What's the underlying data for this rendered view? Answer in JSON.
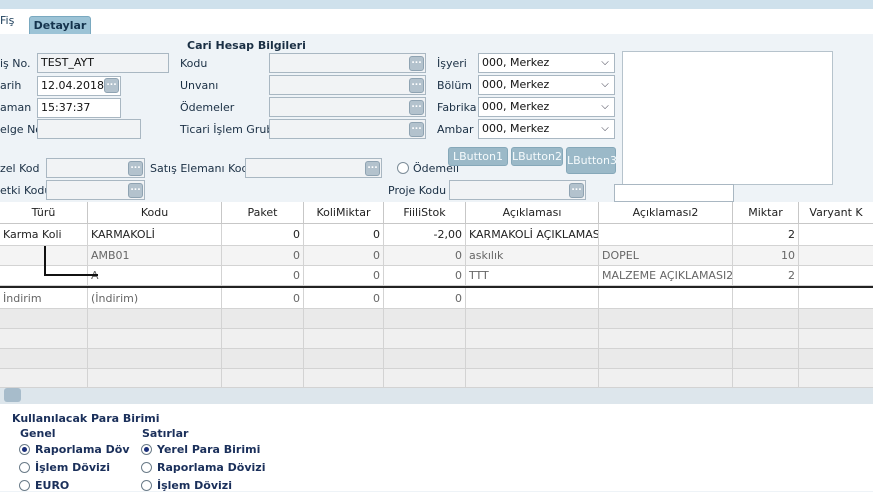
{
  "tabs": {
    "fis": "Fiş",
    "detaylar": "Detaylar"
  },
  "header": {
    "section_title": "Cari Hesap Bilgileri"
  },
  "fields": {
    "fis_no_label": "iş No.",
    "fis_no_value": "TEST_AYT",
    "tarih_label": "arih",
    "tarih_value": "12.04.2018",
    "zaman_label": "aman",
    "zaman_value": "15:37:37",
    "belge_label": "elge No.",
    "belge_value": "",
    "kodu_label": "Kodu",
    "kodu_value": "",
    "unvani_label": "Unvanı",
    "unvani_value": "",
    "odemeler_label": "Ödemeler",
    "odemeler_value": "",
    "ticari_label": "Ticari İşlem Grubu",
    "ticari_value": "",
    "isyeri_label": "İşyeri",
    "isyeri_value": "000, Merkez",
    "bolum_label": "Bölüm",
    "bolum_value": "000, Merkez",
    "fabrika_label": "Fabrika",
    "fabrika_value": "000, Merkez",
    "ambar_label": "Ambar",
    "ambar_value": "000, Merkez",
    "ozel_kod_label": "zel Kod",
    "ozel_kod_value": "",
    "satis_label": "Satış Elemanı Kodu",
    "satis_value": "",
    "odemeli_label": "Ödemeli",
    "yetki_label": "etki Kodu",
    "yetki_value": "",
    "proje_label": "Proje Kodu",
    "proje_value": "",
    "dots": "..."
  },
  "buttons": {
    "lbutton1": "LButton1",
    "lbutton2": "LButton2",
    "lbutton3": "LButton3"
  },
  "grid": {
    "columns": [
      "Türü",
      "Kodu",
      "Paket",
      "KoliMiktar",
      "FiiliStok",
      "Açıklaması",
      "Açıklaması2",
      "Miktar",
      "Varyant K"
    ],
    "rows": [
      {
        "turu": "Karma Koli",
        "kodu": "KARMAKOLİ",
        "paket": "0",
        "koli": "0",
        "fiili": "-2,00",
        "aciklama": "KARMAKOLİ AÇIKLAMASI",
        "aciklama2": "",
        "miktar": "2"
      },
      {
        "turu": "",
        "kodu": "AMB01",
        "paket": "0",
        "koli": "0",
        "fiili": "0",
        "aciklama": "askılık",
        "aciklama2": "DOPEL",
        "miktar": "10"
      },
      {
        "turu": "",
        "kodu": "A",
        "paket": "0",
        "koli": "0",
        "fiili": "0",
        "aciklama": "TTT",
        "aciklama2": "MALZEME AÇIKLAMASI2",
        "miktar": "2"
      },
      {
        "turu": "İndirim",
        "kodu": "(İndirim)",
        "paket": "0",
        "koli": "0",
        "fiili": "0",
        "aciklama": "",
        "aciklama2": "",
        "miktar": ""
      }
    ]
  },
  "currency": {
    "title": "Kullanılacak Para Birimi",
    "genel_title": "Genel",
    "genel_options": [
      "Raporlama Döv",
      "İşlem Dövizi",
      "EURO"
    ],
    "satirlar_title": "Satırlar",
    "satirlar_options": [
      "Yerel Para Birimi",
      "Raporlama Dövizi",
      "İşlem Dövizi"
    ]
  },
  "colors": {
    "accent": "#9cc3d6",
    "button": "#9bb9c8",
    "radio_selected": "#1b2f7a"
  },
  "icons": {
    "combo_arrow": "chevron-down-icon",
    "lookup": "ellipsis-icon"
  }
}
